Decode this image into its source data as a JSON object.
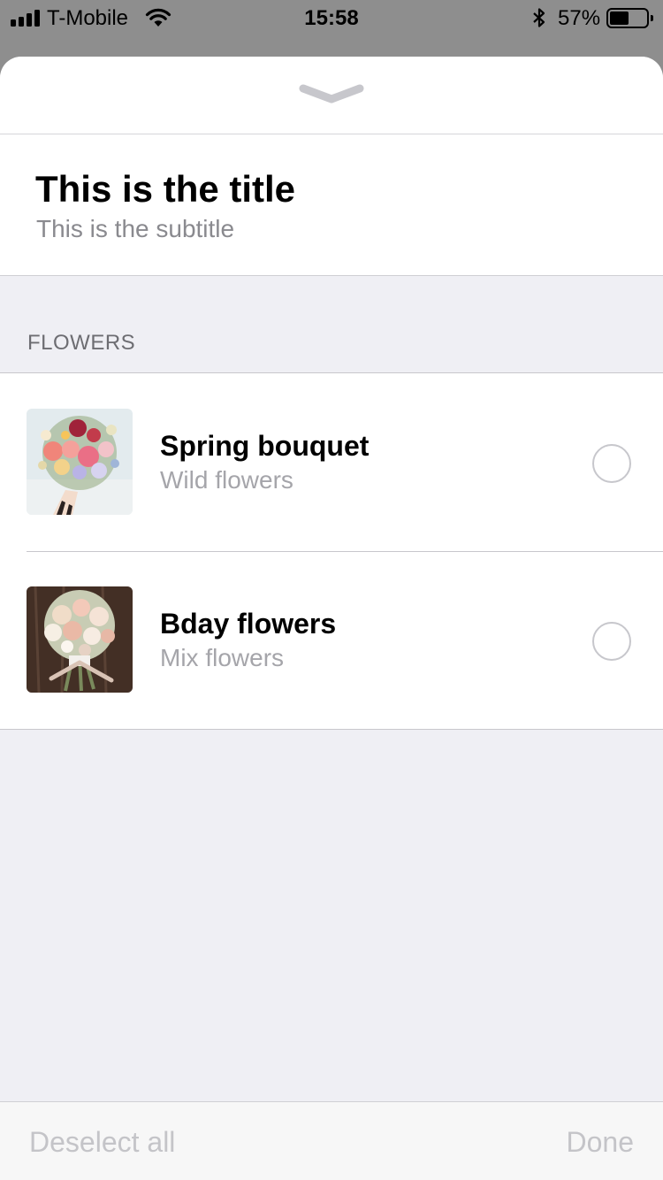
{
  "status_bar": {
    "carrier": "T-Mobile",
    "time": "15:58",
    "battery_percent": "57%",
    "battery_level": 0.57,
    "icons": [
      "signal-icon",
      "wifi-icon",
      "bluetooth-icon",
      "battery-icon"
    ]
  },
  "sheet": {
    "grabber_icon": "chevron-down-icon",
    "title": "This is the title",
    "subtitle": "This is the subtitle",
    "section_header": "FLOWERS",
    "items": [
      {
        "title": "Spring bouquet",
        "subtitle": "Wild flowers",
        "selected": false
      },
      {
        "title": "Bday flowers",
        "subtitle": "Mix flowers",
        "selected": false
      }
    ]
  },
  "toolbar": {
    "deselect_label": "Deselect all",
    "done_label": "Done"
  },
  "colors": {
    "sheet_background": "#efeff4",
    "secondary_text": "#8a8a8f",
    "disabled_text": "#c4c4c8",
    "separator": "#c8c7cc"
  }
}
